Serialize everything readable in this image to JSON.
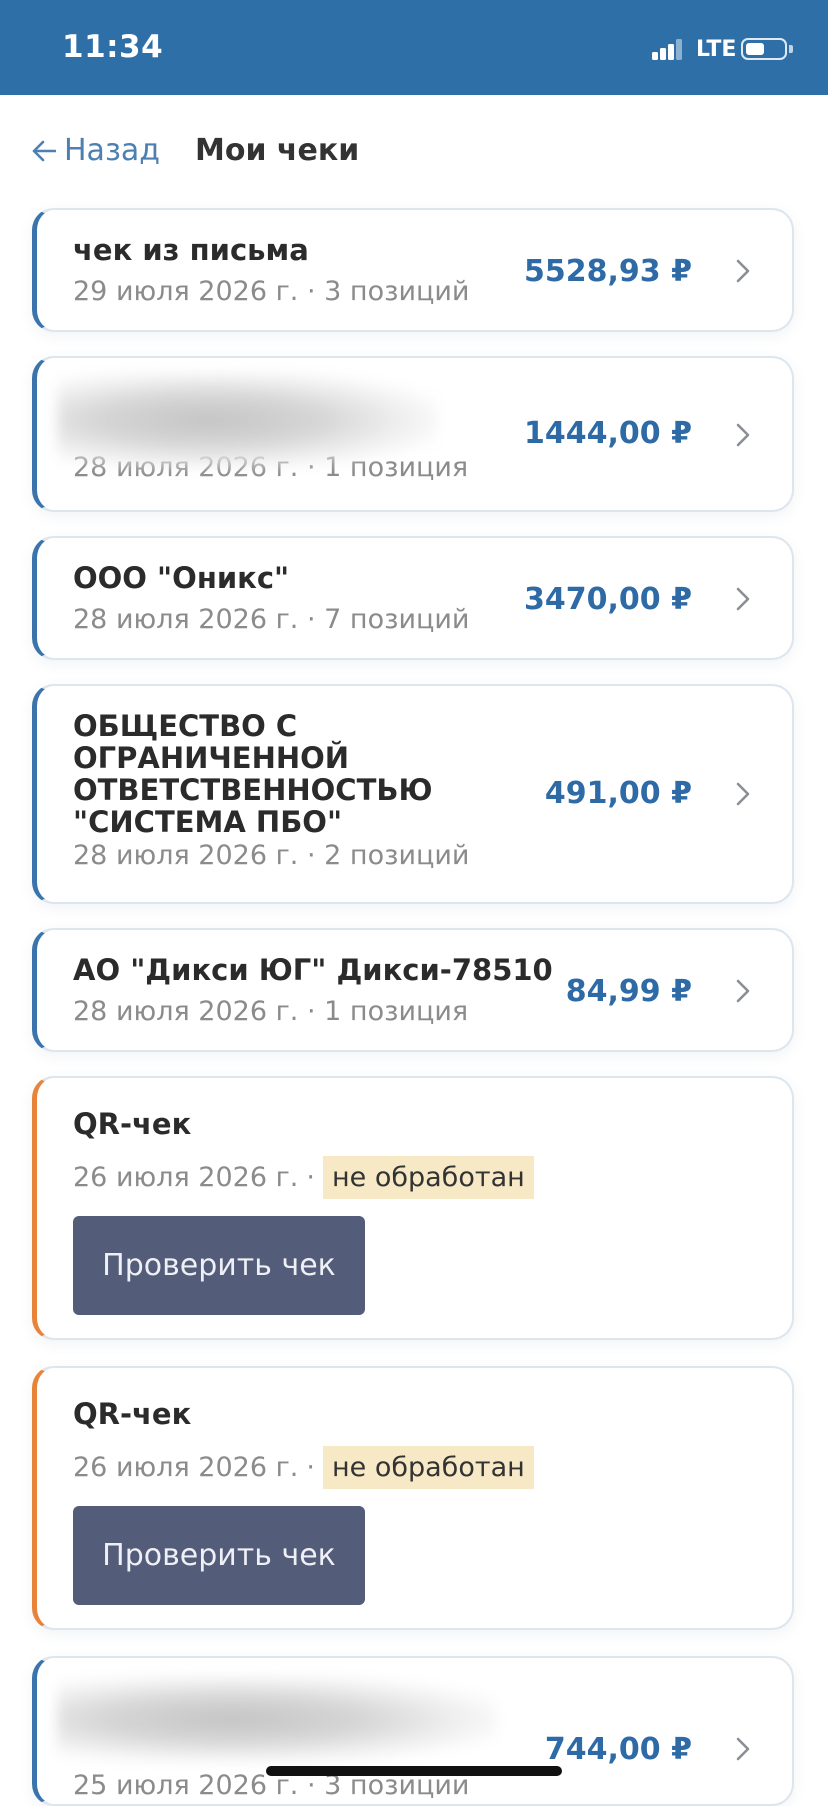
{
  "status": {
    "time": "11:34",
    "network": "LTE"
  },
  "nav": {
    "back_label": "Назад",
    "title": "Мои чеки"
  },
  "receipts": [
    {
      "name": "чек из письма",
      "date": "29 июля 2026 г.",
      "items": "3 позиций",
      "amount": "5528,93 ₽"
    },
    {
      "name": "",
      "date": "28 июля 2026 г.",
      "items": "1 позиция",
      "amount": "1444,00 ₽"
    },
    {
      "name": "ООО \"Оникс\"",
      "date": "28 июля 2026 г.",
      "items": "7 позиций",
      "amount": "3470,00 ₽"
    },
    {
      "name": "ОБЩЕСТВО С ОГРАНИЧЕННОЙ ОТВЕТСТВЕННОСТЬЮ \"СИСТЕМА ПБО\"",
      "date": "28 июля 2026 г.",
      "items": "2 позиций",
      "amount": "491,00 ₽"
    },
    {
      "name": "АО \"Дикси ЮГ\" Дикси-78510",
      "date": "28 июля 2026 г.",
      "items": "1 позиция",
      "amount": "84,99 ₽"
    }
  ],
  "qr_receipts": [
    {
      "name": "QR-чек",
      "date": "26 июля 2026 г.",
      "status": "не обработан",
      "button": "Проверить чек"
    },
    {
      "name": "QR-чек",
      "date": "26 июля 2026 г.",
      "status": "не обработан",
      "button": "Проверить чек"
    }
  ],
  "last_receipt": {
    "name": "",
    "date": "25 июля 2026 г.",
    "items": "3 позиции",
    "amount": "744,00 ₽"
  },
  "separator": "·",
  "colors": {
    "header": "#2f6fa8",
    "amount": "#2e6aa6",
    "accent_blue": "#3b74ad",
    "accent_orange": "#e8833a",
    "button": "#535c79",
    "badge": "#f7e8c6"
  }
}
